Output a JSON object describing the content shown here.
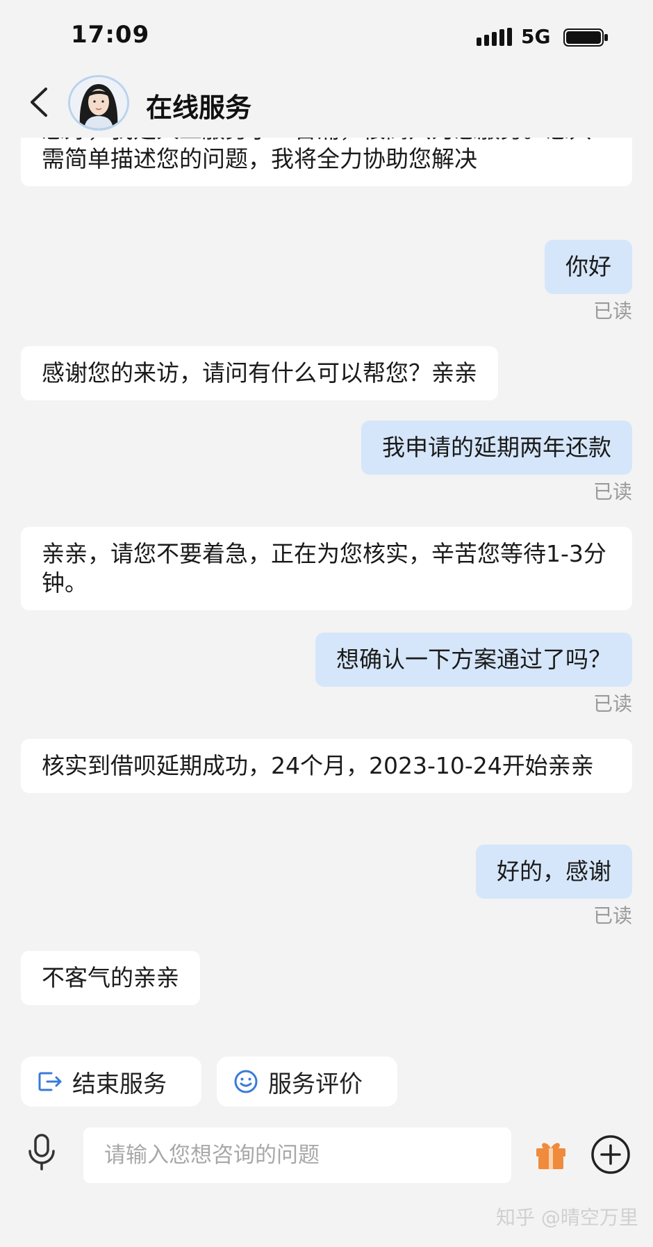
{
  "status_bar": {
    "time": "17:09",
    "network": "5G"
  },
  "header": {
    "back_icon": "back-arrow-icon",
    "title": "在线服务"
  },
  "messages": [
    {
      "side": "in",
      "text": "您好，我是人工服务小二晋浦，很高兴为您服务。您只需简单描述您的问题，我将全力协助您解决"
    },
    {
      "side": "out",
      "text": "你好",
      "status": "已读"
    },
    {
      "side": "in",
      "text": "感谢您的来访，请问有什么可以帮您？亲亲"
    },
    {
      "side": "out",
      "text": "我申请的延期两年还款",
      "status": "已读"
    },
    {
      "side": "in",
      "text": "亲亲，请您不要着急，正在为您核实，辛苦您等待1-3分钟。"
    },
    {
      "side": "out",
      "text": "想确认一下方案通过了吗？",
      "status": "已读"
    },
    {
      "side": "in",
      "text": "核实到借呗延期成功，24个月，2023-10-24开始亲亲"
    },
    {
      "side": "out",
      "text": "好的，感谢",
      "status": "已读"
    },
    {
      "side": "in",
      "text": "不客气的亲亲"
    }
  ],
  "quick_actions": {
    "end_service": {
      "label": "结束服务",
      "icon": "exit-icon"
    },
    "rate_service": {
      "label": "服务评价",
      "icon": "smiley-icon"
    }
  },
  "composer": {
    "placeholder": "请输入您想咨询的问题",
    "value": "",
    "icons": [
      "microphone-icon",
      "gift-icon",
      "plus-icon"
    ]
  },
  "watermark": "知乎 @晴空万里",
  "colors": {
    "background": "#f3f3f3",
    "outgoing_bubble": "#d6e6fa",
    "incoming_bubble": "#ffffff",
    "accent": "#3a7bd5",
    "gift": "#f08a3c"
  }
}
